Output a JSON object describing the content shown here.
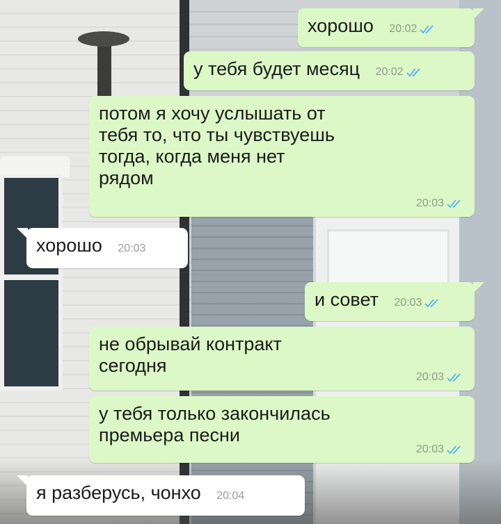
{
  "colors": {
    "outgoing_bubble": "#dcf8c6",
    "incoming_bubble": "#ffffff",
    "read_ticks": "#4fb3f6",
    "timestamp": "#8c9a86"
  },
  "messages": [
    {
      "direction": "out",
      "text": "хорошо",
      "time": "20:02",
      "status_icon": "double-check-read-icon"
    },
    {
      "direction": "out",
      "text": "у тебя будет месяц",
      "time": "20:02",
      "status_icon": "double-check-read-icon"
    },
    {
      "direction": "out",
      "text": "потом я хочу услышать от\nтебя то, что ты чувствуешь\nтогда, когда меня нет\nрядом",
      "time": "20:03",
      "status_icon": "double-check-read-icon"
    },
    {
      "direction": "in",
      "text": "хорошо",
      "time": "20:03"
    },
    {
      "direction": "out",
      "text": "и совет",
      "time": "20:03",
      "status_icon": "double-check-read-icon"
    },
    {
      "direction": "out",
      "text": "не обрывай контракт\nсегодня",
      "time": "20:03",
      "status_icon": "double-check-read-icon"
    },
    {
      "direction": "out",
      "text": "у тебя только закончилась\nпремьера песни",
      "time": "20:03",
      "status_icon": "double-check-read-icon"
    },
    {
      "direction": "in",
      "text": "я разберусь, чонхо",
      "time": "20:04"
    }
  ]
}
